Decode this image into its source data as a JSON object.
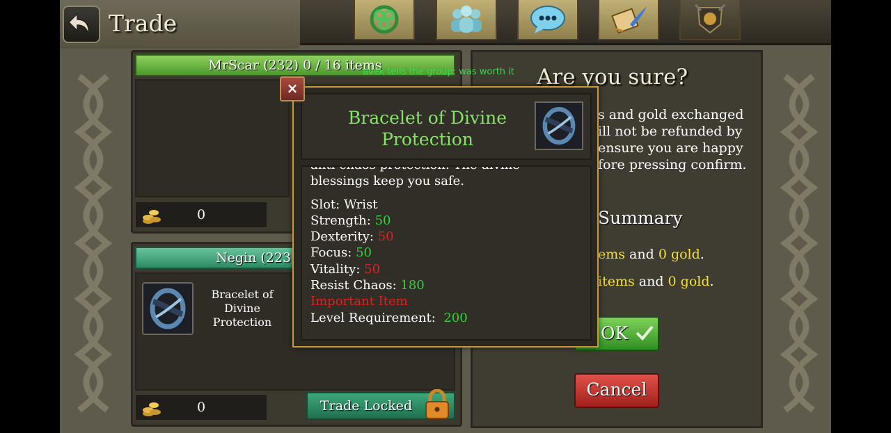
{
  "header": {
    "title": "Trade",
    "tabs": [
      {
        "icon": "triskelion-icon"
      },
      {
        "icon": "group-icon"
      },
      {
        "icon": "chat-bubble-icon"
      },
      {
        "icon": "quest-scroll-icon"
      },
      {
        "icon": "guild-crest-icon"
      }
    ]
  },
  "chat_message": "avek tells the group: was worth it",
  "trade": {
    "player1": {
      "label": "MrScar (232) 0 / 16 items",
      "gold": "0"
    },
    "player2": {
      "label": "Negin (223",
      "gold": "0",
      "item_name": "Bracelet of Divine Protection",
      "lock_label": "Trade Locked"
    }
  },
  "confirm": {
    "title": "Are you sure?",
    "lines": [
      "s and gold exchanged",
      "ill not be refunded by",
      "ensure you are happy",
      "fore pressing confirm."
    ],
    "summary_title": "Summary",
    "summary_line1": {
      "a": "ems",
      "b": " and ",
      "c": "0 gold",
      "d": "."
    },
    "summary_line2": {
      "a": "items",
      "b": " and ",
      "c": "0 gold",
      "d": "."
    },
    "ok_label": "OK",
    "cancel_label": "Cancel"
  },
  "tooltip": {
    "name": "Bracelet of Divine Protection",
    "desc_cut": "anti-chaos protection. The divine",
    "desc_last": "blessings keep you safe.",
    "slot": "Slot: Wrist",
    "stats": [
      {
        "label": "Strength:",
        "value": "50",
        "color": "#34d23a"
      },
      {
        "label": "Dexterity:",
        "value": "50",
        "color": "#e02020"
      },
      {
        "label": "Focus:",
        "value": "50",
        "color": "#34d23a"
      },
      {
        "label": "Vitality:",
        "value": "50",
        "color": "#e02020"
      },
      {
        "label": "Resist Chaos:",
        "value": "180",
        "color": "#34d23a"
      }
    ],
    "important": "Important Item",
    "level_label": "Level Requirement:",
    "level_value": "200",
    "close": "×"
  }
}
